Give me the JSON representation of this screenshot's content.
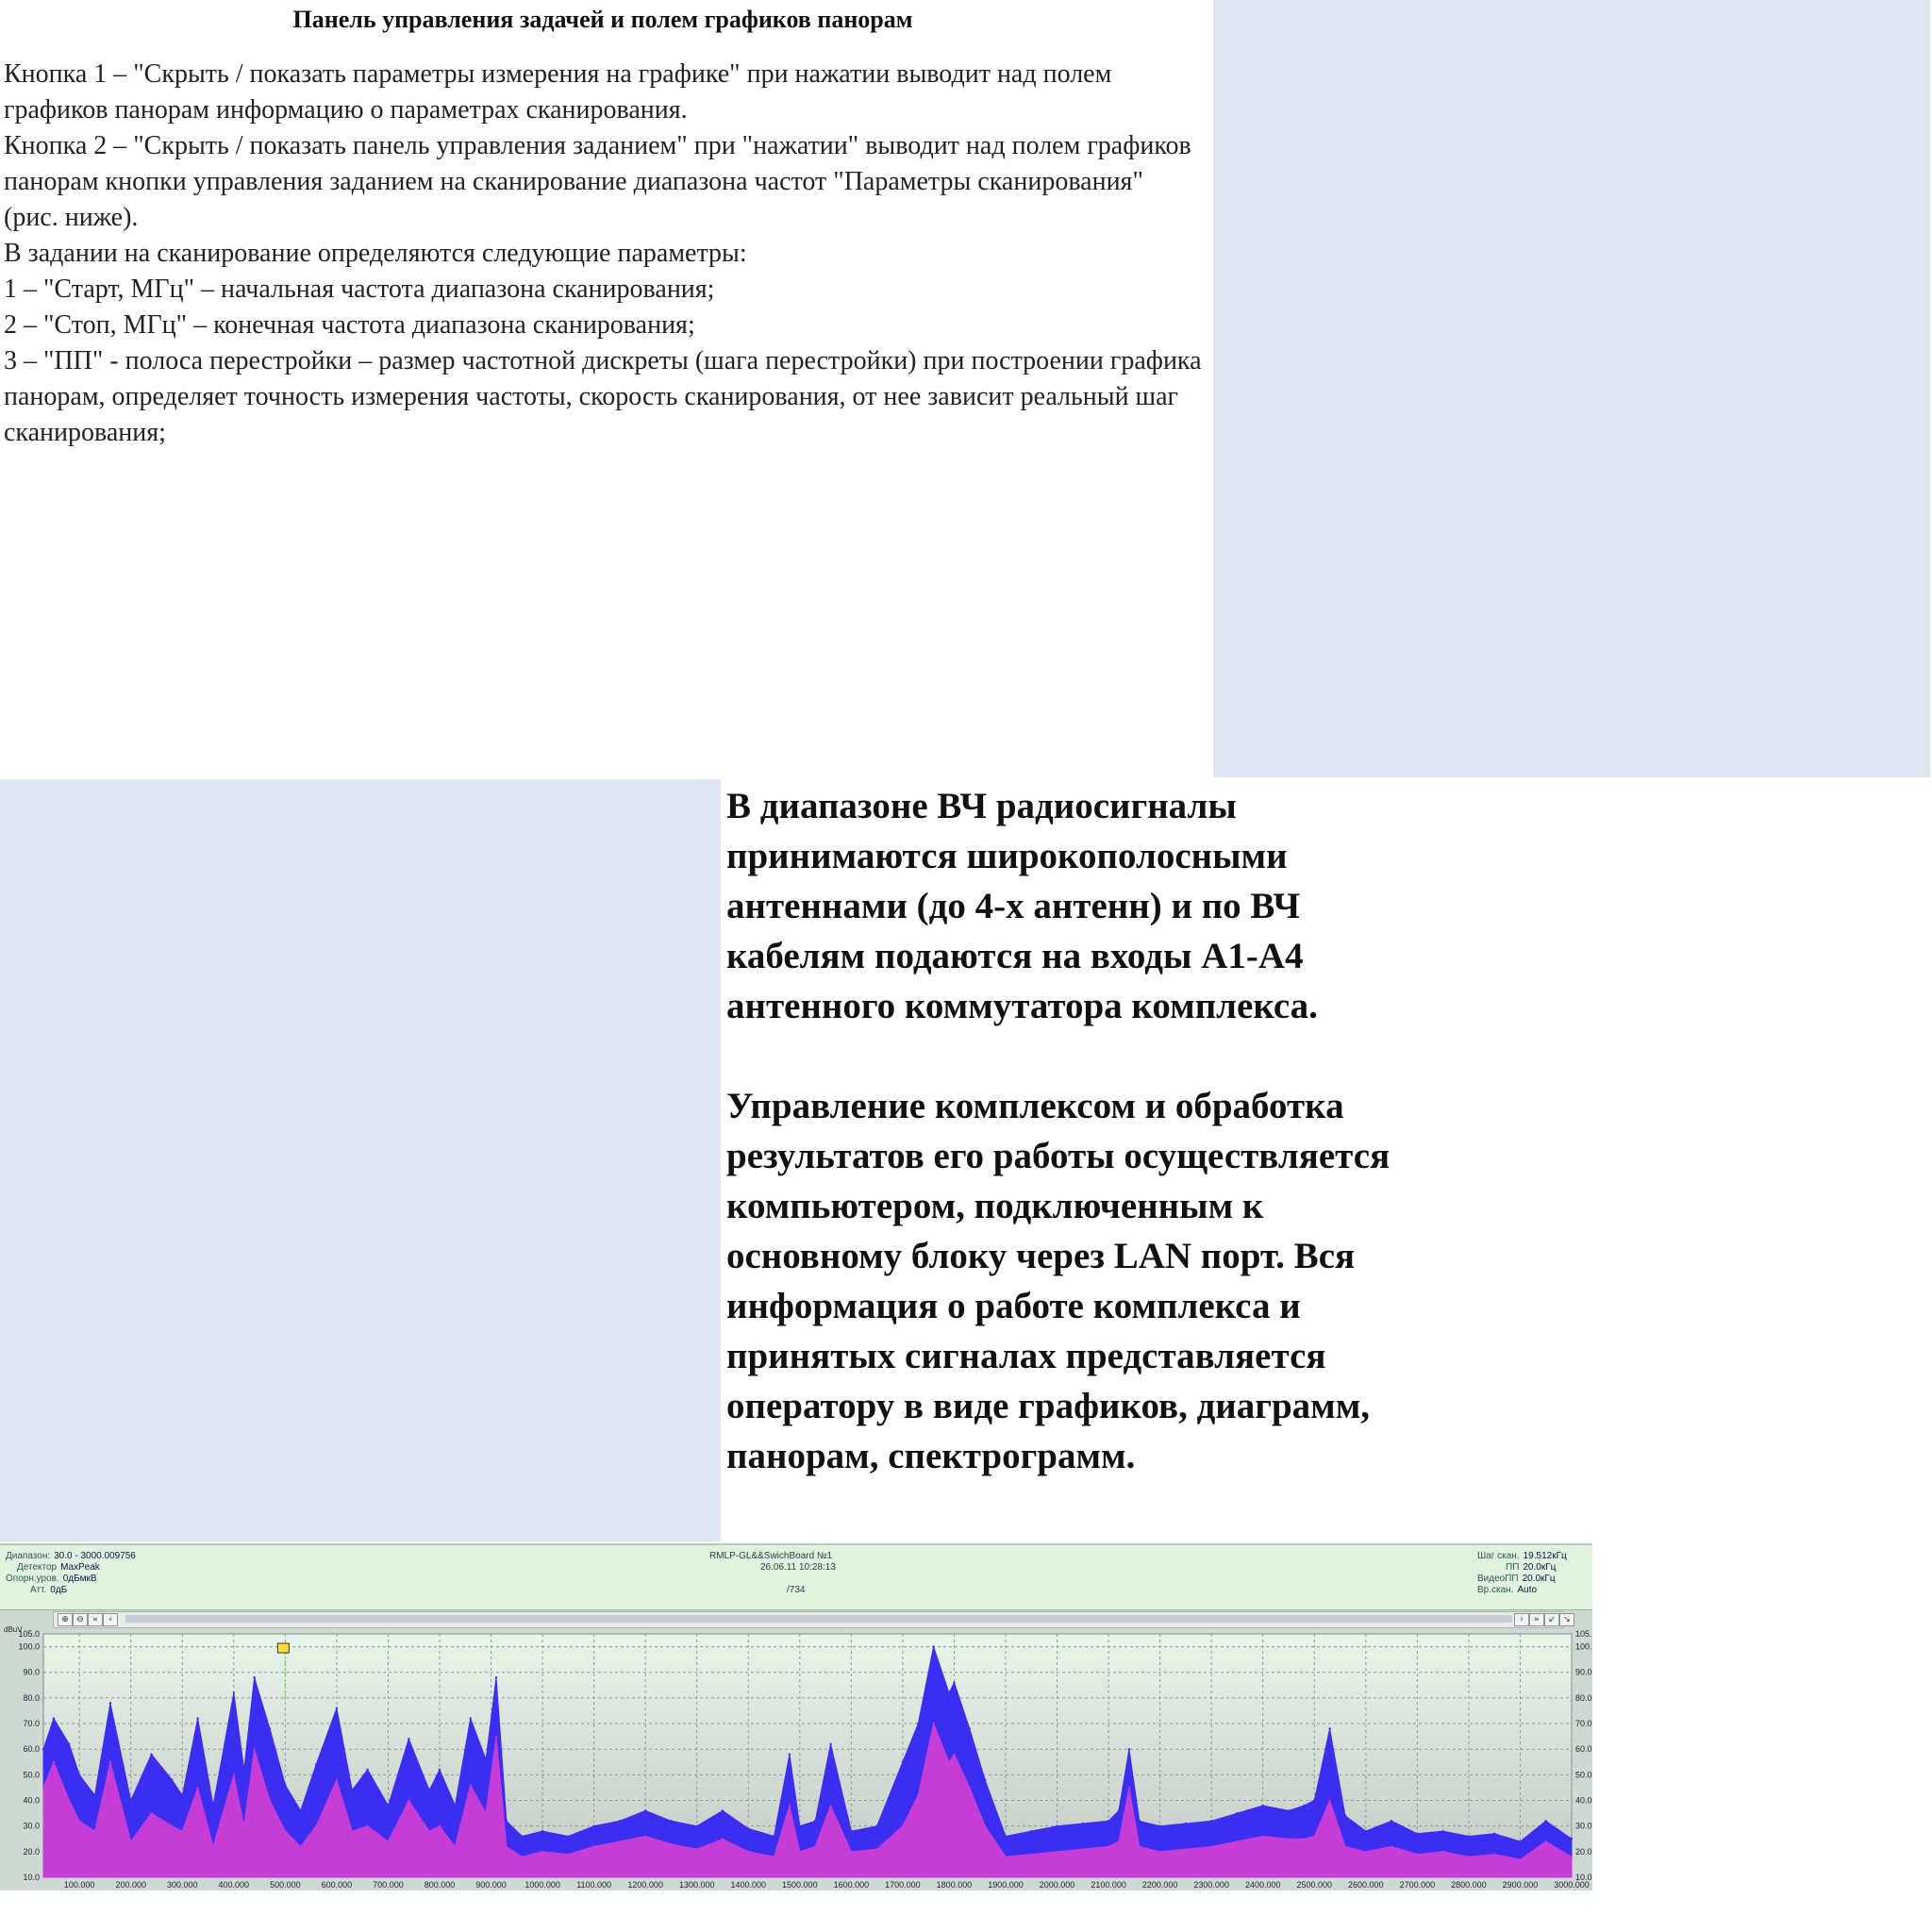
{
  "top": {
    "title": "Панель управления задачей и полем графиков панорам",
    "paragraphs": [
      "Кнопка 1 – \"Скрыть / показать параметры измерения на графике\" при нажатии выводит над полем графиков панорам информацию о параметрах сканирования.",
      "Кнопка 2  – \"Скрыть / показать панель управления заданием\" при \"нажатии\" выводит над полем графиков панорам кнопки управления заданием на сканирование диапазона частот \"Параметры сканирования\" (рис. ниже).",
      "В задании на сканирование определяются следующие параметры:",
      "1 – \"Старт, МГц\" – начальная частота диапазона сканирования;",
      "2 – \"Стоп, МГц\" – конечная частота диапазона сканирования;",
      "3 – \"ПП\" - полоса перестройки – размер частотной дискреты (шага перестройки) при построении графика панорам, определяет точность измерения частоты, скорость сканирования, от нее зависит реальный шаг сканирования;"
    ]
  },
  "big": {
    "para1": "В диапазоне ВЧ радиосигналы принимаются широкополосными антеннами (до 4-х антенн) и по ВЧ кабелям подаются на входы A1-A4 антенного коммутатора комплекса.",
    "para2": "Управление комплексом и обработка результатов его работы осуществляется компьютером, подключенным к основному блоку через LAN порт. Вся информация о работе комплекса и принятых сигналах представляется оператору в виде графиков, диаграмм, панорам, спектрограмм."
  },
  "panorama": {
    "left_info": [
      {
        "label": "Диапазон:",
        "value": "30.0 - 3000.009756"
      },
      {
        "label": "Детектор",
        "value": "MaxPeak"
      },
      {
        "label": "Опорн.уров.",
        "value": "0дБмкВ"
      },
      {
        "label": "Атт.",
        "value": "0дБ"
      }
    ],
    "center_info": [
      "RMLP-GL&&SwichBoard №1",
      "26.06.11 10:28:13",
      "/734"
    ],
    "right_info": [
      {
        "label": "Шаг скан.",
        "value": "19.512кГц"
      },
      {
        "label": "ПП",
        "value": "20.0кГц"
      },
      {
        "label": "ВидеоПП",
        "value": "20.0кГц"
      },
      {
        "label": "Вр.скан.",
        "value": "Auto"
      }
    ],
    "y_unit": "dBuV",
    "y_ticks": [
      "10.0",
      "20.0",
      "30.0",
      "40.0",
      "50.0",
      "60.0",
      "70.0",
      "80.0",
      "90.0",
      "100.0",
      "105.0"
    ],
    "right_ticks": [
      "10.0",
      "20.0",
      "30.0",
      "40.0",
      "50.0",
      "60.0",
      "70.0",
      "80.0",
      "90.0",
      "100.",
      "105."
    ],
    "x_ticks": [
      "100.000",
      "200.000",
      "300.000",
      "400.000",
      "500.000",
      "600.000",
      "700.000",
      "800.000",
      "900.000",
      "1000.000",
      "1100.000",
      "1200.000",
      "1300.000",
      "1400.000",
      "1500.000",
      "1600.000",
      "1700.000",
      "1800.000",
      "1900.000",
      "2000.000",
      "2100.000",
      "2200.000",
      "2300.000",
      "2400.000",
      "2500.000",
      "2600.000",
      "2700.000",
      "2800.000",
      "2900.000",
      "3000.000"
    ],
    "toolbar_left": [
      "⊕",
      "⊖",
      "«",
      "‹"
    ],
    "toolbar_right": [
      "›",
      "»",
      "↙",
      "↘"
    ],
    "colors": {
      "fill": "#c63cd6",
      "peak": "#3b2ef0",
      "bg_top": "#e9f5ea",
      "bg_bottom": "#c4c8c6",
      "grid": "#8e9a94"
    }
  },
  "chart_data": {
    "type": "area",
    "xlabel": "",
    "ylabel": "dBuV",
    "xlim": [
      30,
      3000
    ],
    "ylim": [
      10,
      105
    ],
    "grid": true,
    "x": [
      30,
      50,
      80,
      100,
      130,
      160,
      200,
      240,
      280,
      300,
      330,
      360,
      400,
      420,
      440,
      470,
      500,
      530,
      560,
      600,
      630,
      660,
      700,
      740,
      780,
      800,
      830,
      860,
      890,
      910,
      930,
      960,
      1000,
      1050,
      1100,
      1150,
      1200,
      1250,
      1300,
      1350,
      1400,
      1450,
      1480,
      1500,
      1530,
      1560,
      1600,
      1650,
      1700,
      1730,
      1760,
      1790,
      1800,
      1830,
      1860,
      1900,
      1950,
      2000,
      2050,
      2100,
      2120,
      2140,
      2160,
      2200,
      2250,
      2300,
      2350,
      2400,
      2450,
      2480,
      2500,
      2530,
      2560,
      2600,
      2650,
      2700,
      2750,
      2800,
      2850,
      2900,
      2950,
      3000
    ],
    "series": [
      {
        "values": [
          45,
          55,
          40,
          32,
          28,
          55,
          24,
          35,
          30,
          28,
          45,
          22,
          50,
          30,
          60,
          40,
          28,
          22,
          30,
          48,
          28,
          30,
          24,
          40,
          28,
          30,
          22,
          46,
          35,
          65,
          22,
          18,
          20,
          19,
          22,
          24,
          26,
          23,
          21,
          25,
          20,
          18,
          38,
          20,
          22,
          38,
          20,
          21,
          30,
          42,
          70,
          55,
          58,
          45,
          30,
          18,
          19,
          20,
          21,
          22,
          24,
          45,
          22,
          20,
          21,
          22,
          24,
          26,
          25,
          25,
          26,
          40,
          22,
          20,
          22,
          19,
          20,
          18,
          19,
          17,
          24,
          18
        ]
      },
      {
        "values": [
          60,
          72,
          62,
          50,
          42,
          78,
          40,
          58,
          48,
          42,
          72,
          38,
          82,
          52,
          88,
          68,
          46,
          36,
          54,
          76,
          44,
          52,
          38,
          64,
          44,
          52,
          38,
          72,
          56,
          88,
          32,
          26,
          28,
          26,
          30,
          32,
          36,
          32,
          30,
          36,
          29,
          26,
          58,
          30,
          32,
          62,
          28,
          30,
          55,
          70,
          100,
          82,
          86,
          68,
          48,
          26,
          28,
          30,
          31,
          32,
          36,
          60,
          32,
          30,
          31,
          32,
          35,
          38,
          36,
          38,
          40,
          68,
          34,
          28,
          32,
          27,
          28,
          26,
          27,
          24,
          32,
          25
        ]
      }
    ]
  }
}
